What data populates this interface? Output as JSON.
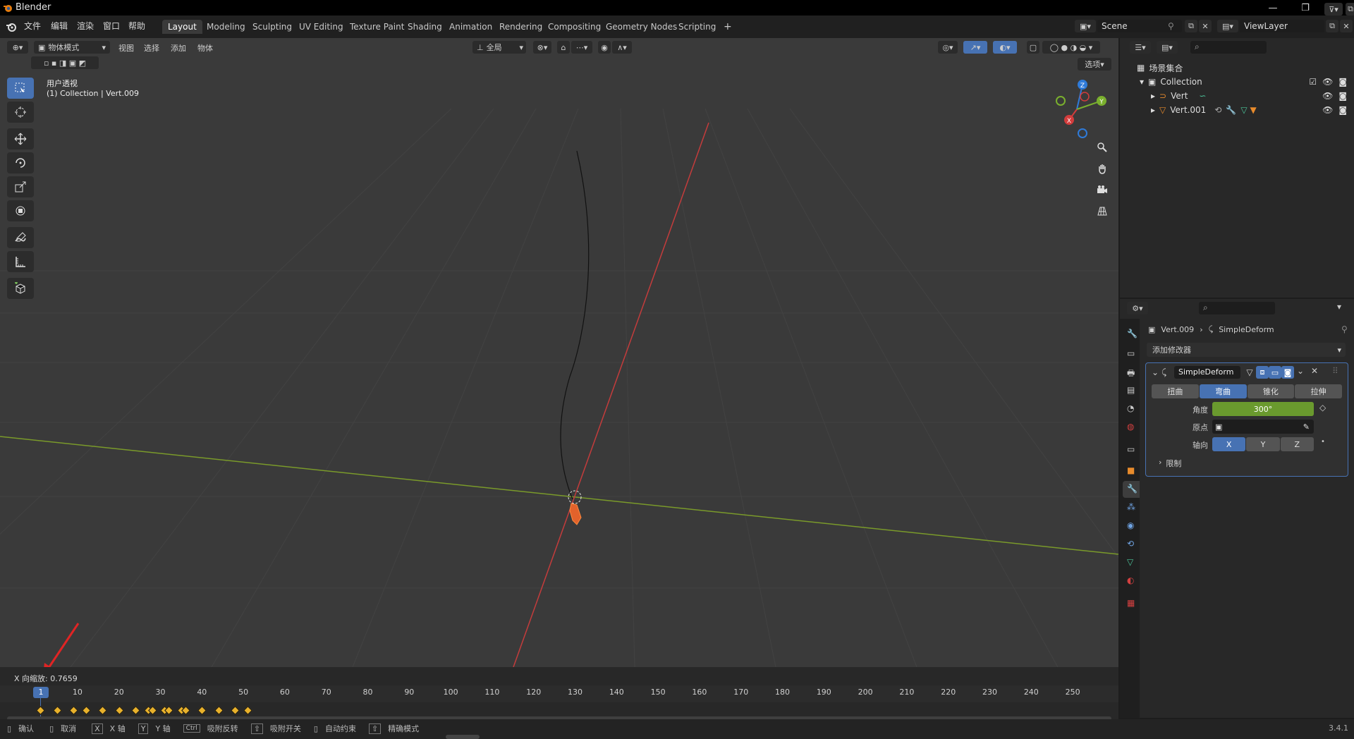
{
  "app": {
    "title": "Blender",
    "version": "3.4.1"
  },
  "menu": {
    "items": [
      "文件",
      "编辑",
      "渲染",
      "窗口",
      "帮助"
    ]
  },
  "workspaces": {
    "tabs": [
      "Layout",
      "Modeling",
      "Sculpting",
      "UV Editing",
      "Texture Paint",
      "Shading",
      "Animation",
      "Rendering",
      "Compositing",
      "Geometry Nodes",
      "Scripting"
    ],
    "active": "Layout",
    "add": "+"
  },
  "scene": {
    "name": "Scene",
    "view_layer": "ViewLayer"
  },
  "viewport": {
    "mode": "物体模式",
    "menus": [
      "视图",
      "选择",
      "添加",
      "物体"
    ],
    "transform_orientation": "全局",
    "options": "选项",
    "view_name": "用户透视",
    "collection_info": "(1) Collection | Vert.009",
    "gizmo": {
      "z": "Z",
      "y": "Y",
      "x": "X"
    },
    "operator_info": "X 向缩放: 0.7659",
    "colors": {
      "bg": "#3c3c3c",
      "x_axis": "#c43c3c",
      "y_axis": "#7a9a2a",
      "selected": "#e2622b"
    }
  },
  "timeline": {
    "current_frame": "1",
    "ticks": [
      "10",
      "20",
      "30",
      "40",
      "50",
      "60",
      "70",
      "80",
      "90",
      "100",
      "110",
      "120",
      "130",
      "140",
      "150",
      "160",
      "170",
      "180",
      "190",
      "200",
      "210",
      "220",
      "230",
      "240",
      "250"
    ],
    "keyframes": [
      1,
      5,
      9,
      12,
      16,
      20,
      24,
      27,
      28,
      31,
      32,
      35,
      36,
      40,
      44,
      48,
      51
    ]
  },
  "statusbar": {
    "items": [
      {
        "key": "",
        "label": "确认"
      },
      {
        "key": "",
        "label": "取消"
      },
      {
        "key": "X",
        "label": "X 轴"
      },
      {
        "key": "Y",
        "label": "Y 轴"
      },
      {
        "key": "Ctrl",
        "label": "吸附反转"
      },
      {
        "key": "⇧",
        "label": "吸附开关"
      },
      {
        "key": "",
        "label": "自动约束"
      },
      {
        "key": "⇧",
        "label": "精确模式"
      }
    ],
    "version": "3.4.1"
  },
  "outliner": {
    "root": "场景集合",
    "collection": "Collection",
    "objects": [
      "Vert",
      "Vert.001"
    ]
  },
  "properties": {
    "breadcrumb_object": "Vert.009",
    "breadcrumb_modifier": "SimpleDeform",
    "add_modifier": "添加修改器",
    "modifier": {
      "name": "SimpleDeform",
      "methods": [
        "扭曲",
        "弯曲",
        "锥化",
        "拉伸"
      ],
      "active_method": "弯曲",
      "angle_label": "角度",
      "angle_value": "300°",
      "origin_label": "原点",
      "axis_label": "轴向",
      "axes": [
        "X",
        "Y",
        "Z"
      ],
      "active_axis": "X",
      "restrictions": "限制"
    }
  }
}
